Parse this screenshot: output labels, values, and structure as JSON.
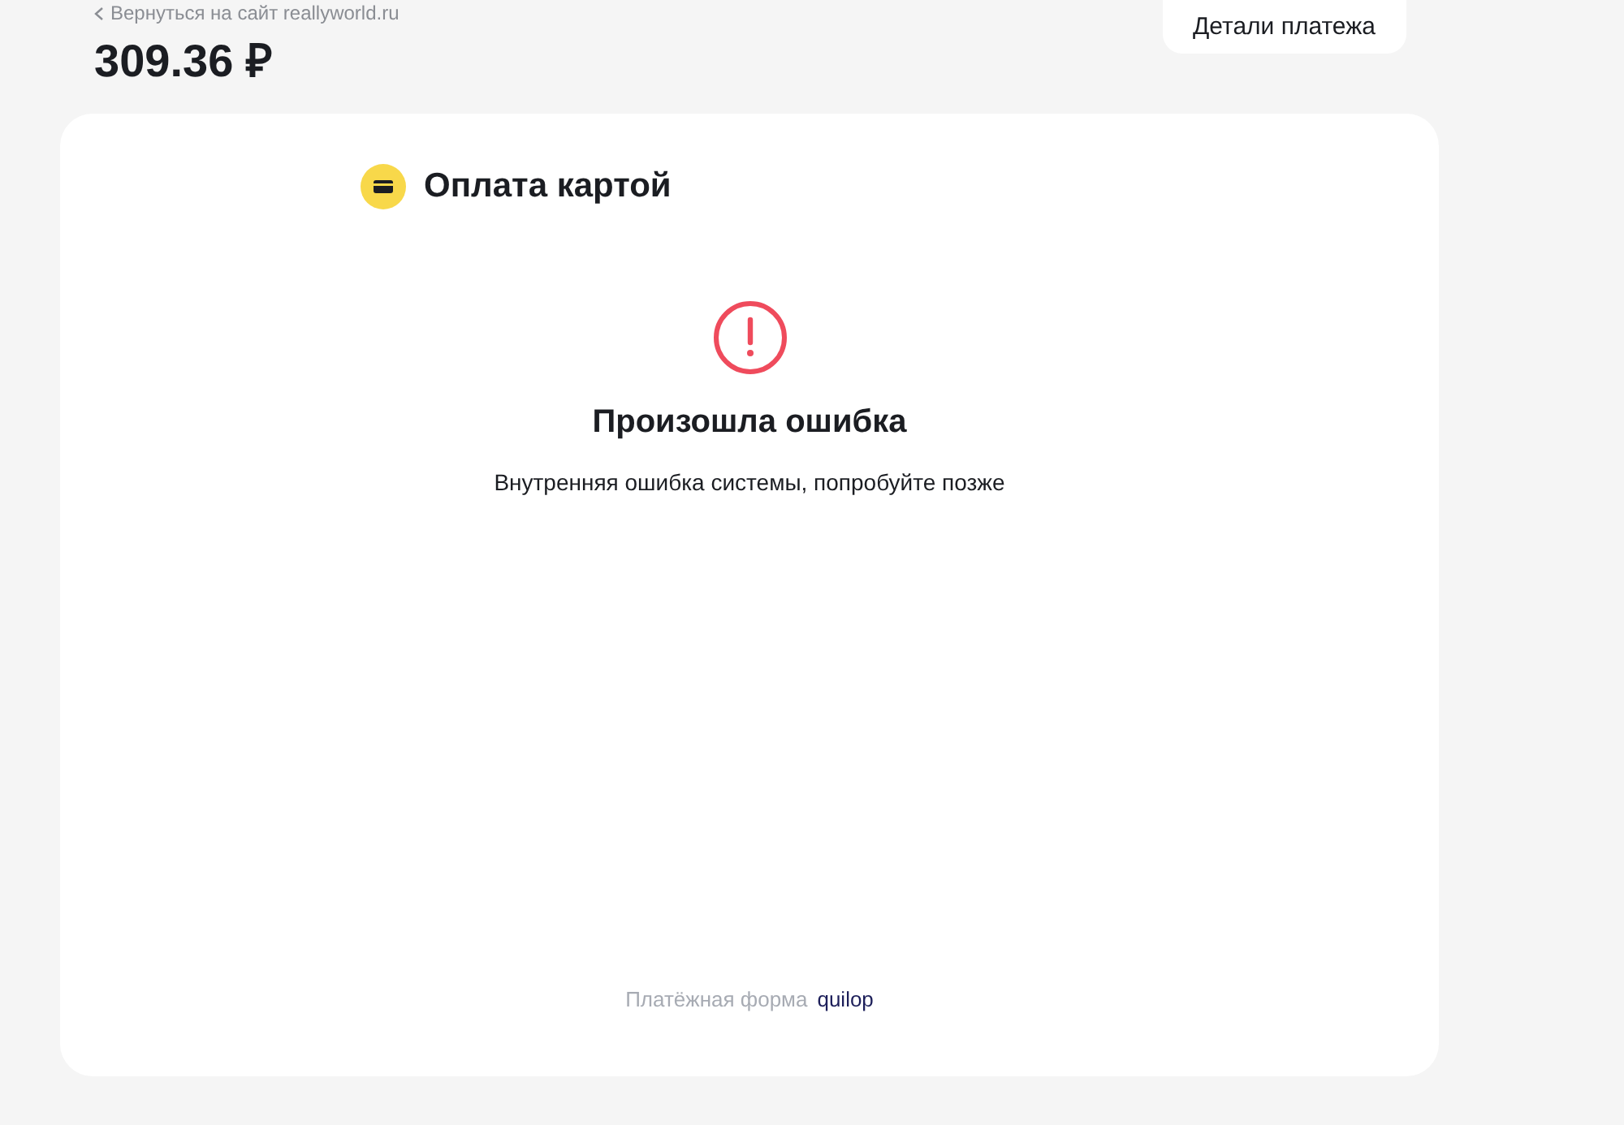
{
  "header": {
    "back_link": "Вернуться на сайт reallyworld.ru",
    "amount": "309.36 ₽",
    "details_button": "Детали платежа"
  },
  "card": {
    "title": "Оплата картой",
    "error": {
      "heading": "Произошла ошибка",
      "message": "Внутренняя ошибка системы, попробуйте позже"
    },
    "footer": {
      "label": "Платёжная форма",
      "brand": "quilop"
    }
  }
}
